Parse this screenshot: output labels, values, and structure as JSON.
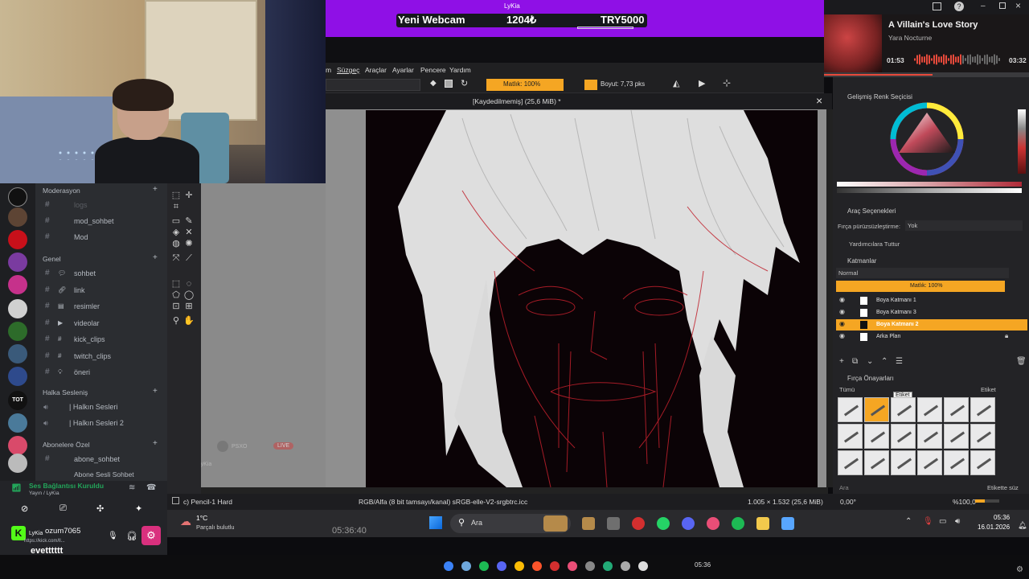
{
  "webcam": {},
  "banner": {
    "window_title": "LyKia",
    "label": "Yeni Webcam",
    "current": "1204₺",
    "goal": "TRY5000"
  },
  "music": {
    "title": "A Villain's Love Story",
    "artist": "Yara Nocturne",
    "elapsed": "01:53",
    "total": "03:32",
    "progress": 0.53,
    "accent": "#e74a3b"
  },
  "krita": {
    "menu": [
      "m",
      "Süzgeç",
      "Araçlar",
      "Ayarlar",
      "Pencere",
      "Yardım"
    ],
    "opacity_label": "Matlık: 100%",
    "size_label": "Boyut: 7,73 pks",
    "doc_title": "[Kaydedilmemiş]  (25,6 MiB) *",
    "accent": "#f5a623",
    "brush_name": "c) Pencil-1 Hard",
    "color_info": "RGB/Alfa (8 bit tamsayı/kanal)  sRGB-elle-V2-srgbtrc.icc",
    "dimensions": "1.005 × 1.532 (25,6 MiB)",
    "angle": "0,00°",
    "zoom": "%100,0"
  },
  "docker": {
    "color_panel": "Gelişmiş Renk Seçicisi",
    "tool_options": "Araç Seçenekleri",
    "smoothing_label": "Fırça pürüzsüzleştirme:",
    "smoothing_value": "Yok",
    "assist_label": "Yardımcılara Tuttur",
    "layers_title": "Katmanlar",
    "blend_mode": "Normal",
    "layer_opacity": "Matlık:  100%",
    "layers": [
      {
        "name": "Boya Katmanı 1",
        "active": false
      },
      {
        "name": "Boya Katmanı 3",
        "active": false
      },
      {
        "name": "Boya Katmanı 2",
        "active": true
      },
      {
        "name": "Arka Plan",
        "active": false
      }
    ],
    "presets_title": "Fırça Önayarları",
    "presets_filter": "Tümü",
    "tag_label": "Etiket",
    "tooltip": "Etiket",
    "search_placeholder": "Ara",
    "tag_delete": "Etikette süz"
  },
  "discord": {
    "categories": {
      "moderation": "Moderasyon",
      "general": "Genel",
      "voice": "Halka Sesleniş",
      "subscribers": "Abonelere Özel"
    },
    "mod_channels": [
      "logs",
      "mod_sohbet",
      "Mod"
    ],
    "general_channels": [
      "sohbet",
      "link",
      "resimler",
      "videolar",
      "kick_clips",
      "twitch_clips",
      "öneri"
    ],
    "voice_channels": [
      "| Halkın Sesleri",
      "| Halkın Sesleri 2"
    ],
    "sub_channels": [
      "abone_sohbet",
      "Abone Sesli Sohbet"
    ],
    "voice_status": "Ses Bağlantısı Kuruldu",
    "voice_sub": "Yayın / LyKia",
    "user": "ozum7065",
    "user_tag": "LyKia",
    "user_link": "https://kick.com/ll..."
  },
  "chat": {
    "message": "evetttttt",
    "overlay_time": "05:36:40",
    "weather": "1°C",
    "weather_sub": "Parçalı bulutlu",
    "live": "LIVE",
    "psxo": "PSXO"
  },
  "taskbar": {
    "search": "Ara",
    "time": "05:36",
    "date": "16.01.2026",
    "time2": "05:36"
  }
}
